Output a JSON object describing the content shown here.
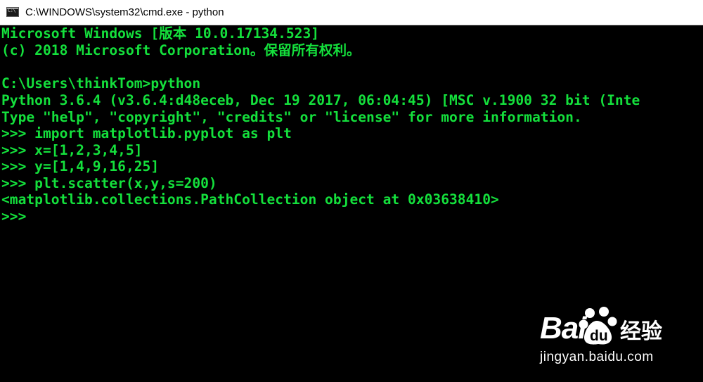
{
  "window": {
    "title": "C:\\WINDOWS\\system32\\cmd.exe - python",
    "icon": "cmd-icon"
  },
  "console": {
    "text_color": "#14e03c",
    "background": "#000000",
    "lines": [
      "Microsoft Windows [版本 10.0.17134.523]",
      "(c) 2018 Microsoft Corporation。保留所有权利。",
      "",
      "C:\\Users\\thinkTom>python",
      "Python 3.6.4 (v3.6.4:d48eceb, Dec 19 2017, 06:04:45) [MSC v.1900 32 bit (Inte",
      "Type \"help\", \"copyright\", \"credits\" or \"license\" for more information.",
      ">>> import matplotlib.pyplot as plt",
      ">>> x=[1,2,3,4,5]",
      ">>> y=[1,4,9,16,25]",
      ">>> plt.scatter(x,y,s=200)",
      "<matplotlib.collections.PathCollection object at 0x03638410>",
      ">>>"
    ]
  },
  "watermark": {
    "brand_left": "Bai",
    "brand_icon": "baidu-paw-icon",
    "brand_right": "经验",
    "url": "jingyan.baidu.com"
  }
}
